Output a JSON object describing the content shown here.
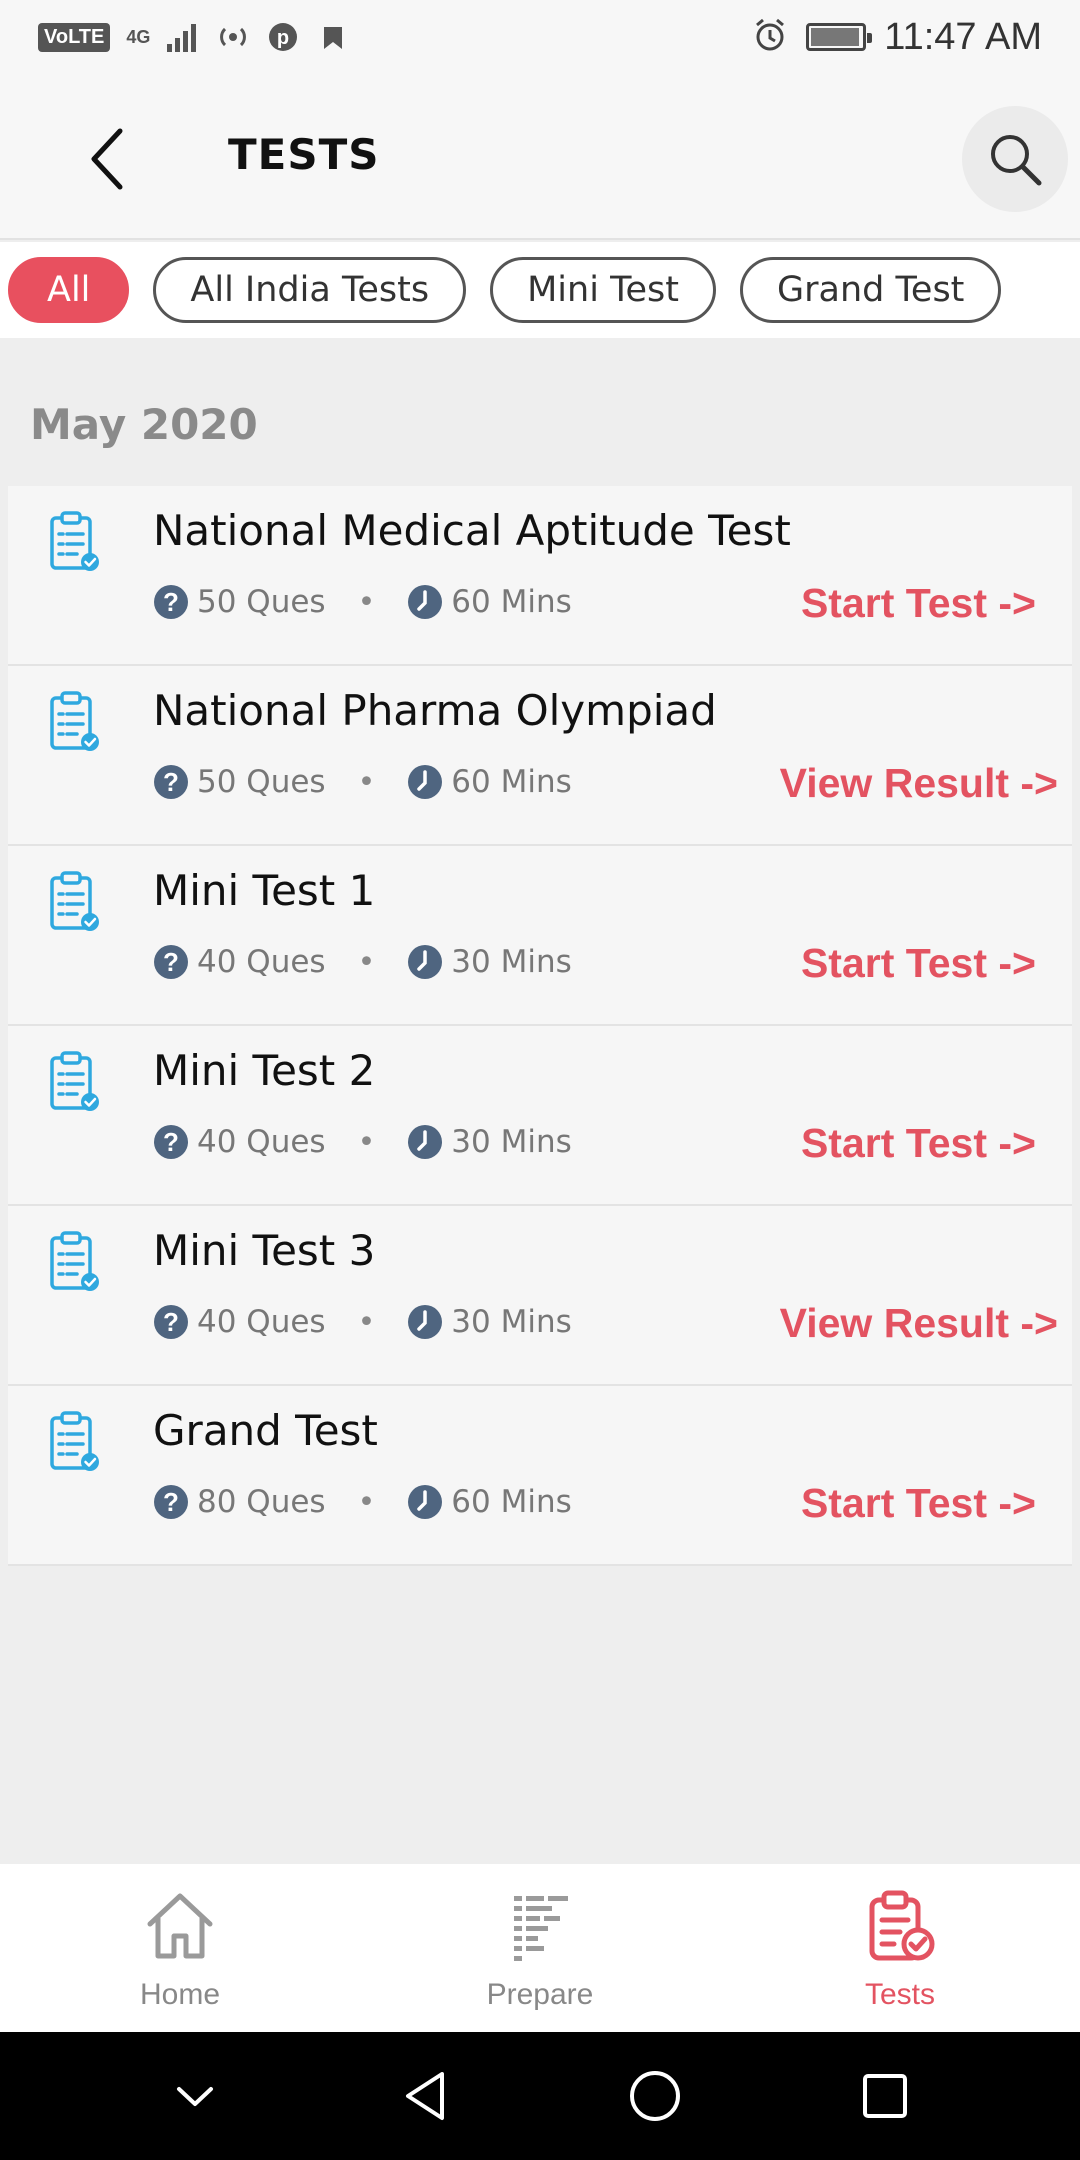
{
  "status_bar": {
    "volte": "VoLTE",
    "network": "4G",
    "hotspot_count": "1",
    "time": "11:47 AM"
  },
  "header": {
    "title": "TESTS"
  },
  "filters": [
    {
      "label": "All",
      "active": true
    },
    {
      "label": "All India Tests",
      "active": false
    },
    {
      "label": "Mini Test",
      "active": false
    },
    {
      "label": "Grand Test",
      "active": false
    }
  ],
  "month": "May 2020",
  "tests": [
    {
      "name": "National Medical Aptitude Test",
      "questions": "50 Ques",
      "duration": "60 Mins",
      "action": "Start Test ->"
    },
    {
      "name": "National Pharma Olympiad",
      "questions": "50 Ques",
      "duration": "60 Mins",
      "action": "View Result ->"
    },
    {
      "name": "Mini Test 1",
      "questions": "40 Ques",
      "duration": "30 Mins",
      "action": "Start Test ->"
    },
    {
      "name": "Mini Test 2",
      "questions": "40 Ques",
      "duration": "30 Mins",
      "action": "Start Test ->"
    },
    {
      "name": "Mini Test 3",
      "questions": "40 Ques",
      "duration": "30 Mins",
      "action": "View Result ->"
    },
    {
      "name": "Grand Test",
      "questions": "80 Ques",
      "duration": "60 Mins",
      "action": "Start Test ->"
    }
  ],
  "bottom_nav": [
    {
      "label": "Home",
      "icon": "home-icon",
      "active": false
    },
    {
      "label": "Prepare",
      "icon": "prepare-icon",
      "active": false
    },
    {
      "label": "Tests",
      "icon": "tests-icon",
      "active": true
    }
  ],
  "colors": {
    "accent": "#e35361",
    "chip_active": "#e8505f",
    "list_icon": "#2fa8df",
    "meta_icon": "#4f6580"
  }
}
